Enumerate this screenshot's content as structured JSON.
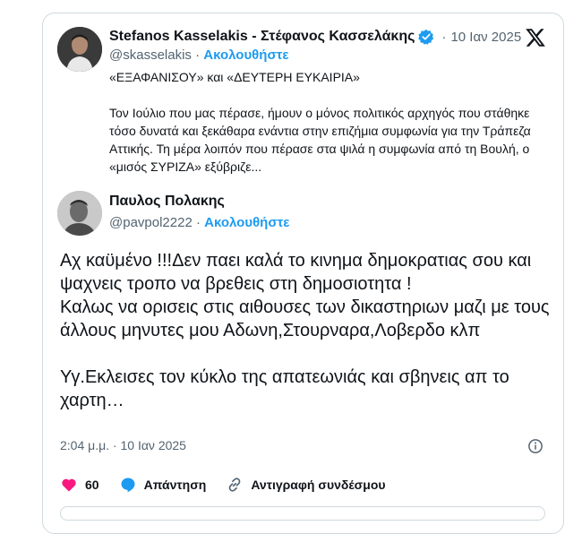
{
  "parent": {
    "name": "Stefanos Kasselakis - Στέφανος Κασσελάκης",
    "date": "10 Ιαν 2025",
    "handle": "@skasselakis",
    "separator": "·",
    "follow_label": "Ακολουθήστε",
    "title_line": "«ΕΞΑΦΑΝΙΣΟΥ» και «ΔΕΥΤΕΡΗ ΕΥΚΑΙΡΙΑ»",
    "body": "Τον Ιούλιο που μας πέρασε, ήμουν ο μόνος πολιτικός αρχηγός που στάθηκε τόσο δυνατά και ξεκάθαρα ενάντια στην επιζήμια συμφωνία για την Τράπεζα Αττικής. Τη μέρα λοιπόν που πέρασε στα ψιλά η συμφωνία από τη Βουλή, ο «μισός ΣΥΡΙΖΑ» εξύβριζε..."
  },
  "reply": {
    "name": "Παυλος Πολακης",
    "handle": "@pavpol2222",
    "separator": "·",
    "follow_label": "Ακολουθήστε",
    "text": "Αχ καϋμένο !!!Δεν παει καλά το κινημα δημοκρατιας σου και ψαχνεις τροπο να βρεθεις στη δημοσιοτητα !\nΚαλως να ορισεις  στις αιθουσες των δικαστηριων μαζι με τους άλλους μηνυτες μου Αδωνη,Στουρναρα,Λοβερδο κλπ\n\nΥγ.Εκλεισες τον κύκλο της απατεωνιάς και σβηνεις απ το χαρτη…",
    "timestamp": "2:04 μ.μ. · 10 Ιαν 2025"
  },
  "actions": {
    "likes": "60",
    "reply_label": "Απάντηση",
    "copy_label": "Αντιγραφή συνδέσμου"
  },
  "colors": {
    "accent": "#1d9bf0",
    "like": "#f91880",
    "text": "#0f1419",
    "muted": "#536471",
    "border": "#cfd9de"
  },
  "icons": [
    "verified-badge-icon",
    "x-logo-icon",
    "info-icon",
    "heart-icon",
    "reply-bubble-icon",
    "link-icon"
  ]
}
